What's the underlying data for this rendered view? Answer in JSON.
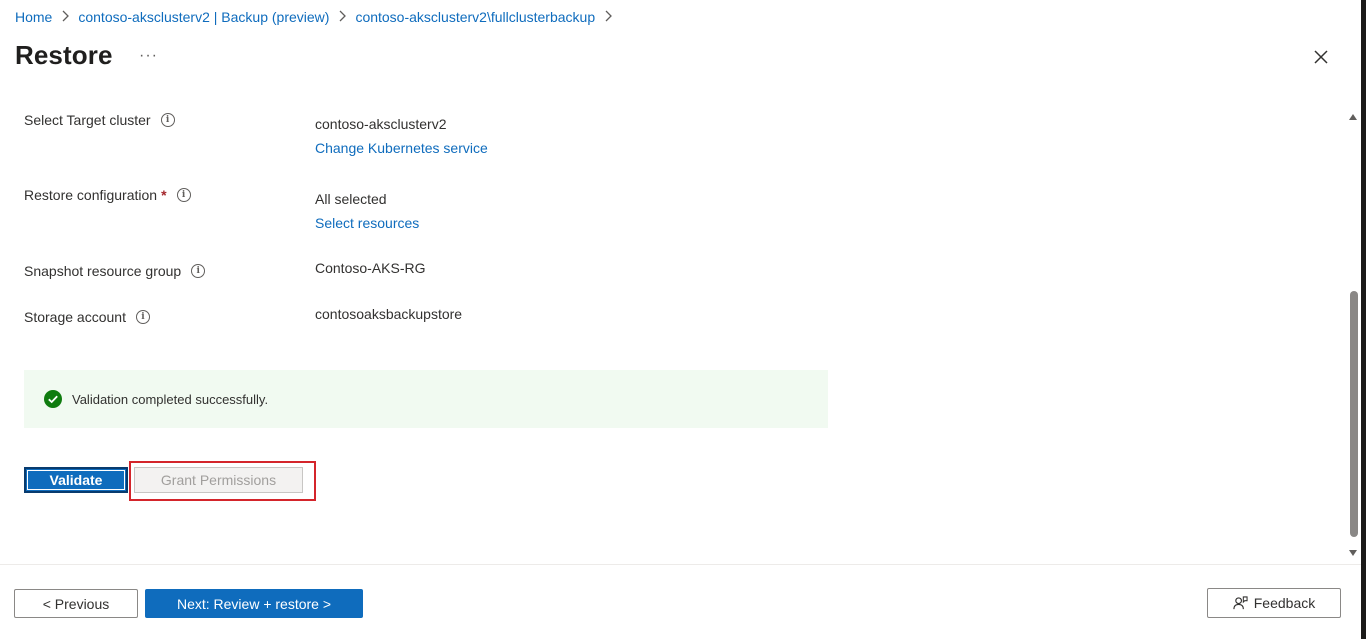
{
  "breadcrumb": {
    "items": [
      {
        "label": "Home"
      },
      {
        "label": "contoso-aksclusterv2 | Backup (preview)"
      },
      {
        "label": "contoso-aksclusterv2\\fullclusterbackup"
      }
    ]
  },
  "header": {
    "title": "Restore",
    "more_label": "···"
  },
  "form": {
    "target_cluster": {
      "label": "Select Target cluster",
      "value": "contoso-aksclusterv2",
      "link": "Change Kubernetes service"
    },
    "restore_configuration": {
      "label": "Restore configuration",
      "required_mark": "*",
      "value": "All selected",
      "link": "Select resources"
    },
    "snapshot_resource_group": {
      "label": "Snapshot resource group",
      "value": "Contoso-AKS-RG"
    },
    "storage_account": {
      "label": "Storage account",
      "value": "contosoaksbackupstore"
    },
    "info_glyph": "i"
  },
  "validation": {
    "message": "Validation completed successfully.",
    "status_color": "#107c10"
  },
  "actions": {
    "validate_label": "Validate",
    "grant_permissions_label": "Grant Permissions"
  },
  "footer": {
    "previous_label": "< Previous",
    "next_label": "Next: Review + restore >",
    "feedback_label": "Feedback"
  },
  "colors": {
    "accent": "#0f6cbd",
    "highlight": "#d4252b",
    "success_bg": "#f1faf1"
  }
}
